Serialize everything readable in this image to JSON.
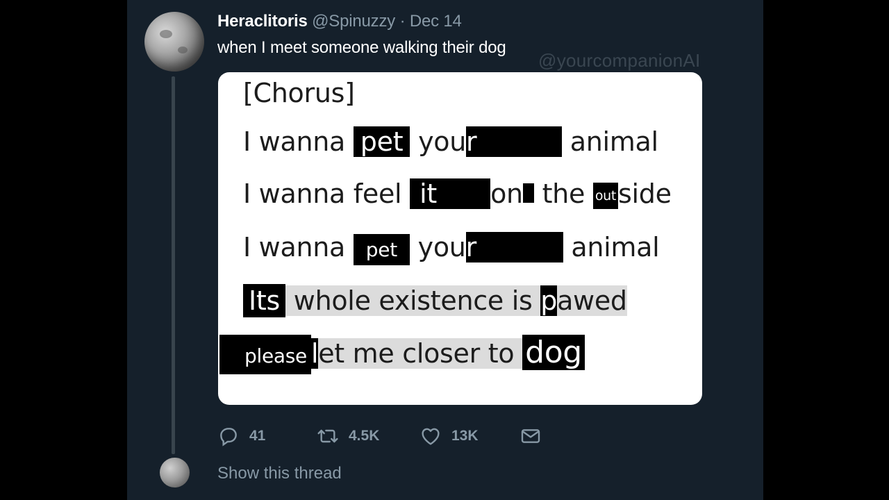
{
  "tweet": {
    "display_name": "Heraclitoris",
    "handle": "@Spinuzzy",
    "separator": "·",
    "date": "Dec 14",
    "text": "when I meet someone walking their dog",
    "watermark": "@yourcompanionAI"
  },
  "lyrics": {
    "header": "[Chorus]",
    "line1": {
      "a": "I wanna ",
      "b": "pet",
      "c": " you",
      "d": "r",
      "e": " animal"
    },
    "line2": {
      "a": "I wanna feel ",
      "b": "it",
      "c": "on",
      "d": " the ",
      "e": "out",
      "f": "side"
    },
    "line3": {
      "a": "I wanna ",
      "b": "pet",
      "c": " you",
      "d": "r",
      "e": " animal"
    },
    "line4": {
      "a": "Its",
      "b": " whole existence is ",
      "c": "p",
      "d": "awed"
    },
    "line5": {
      "a": "please ",
      "b": "l",
      "c": "et me closer to ",
      "d": "dog"
    }
  },
  "actions": {
    "reply": {
      "icon": "reply-icon",
      "count": "41"
    },
    "retweet": {
      "icon": "retweet-icon",
      "count": "4.5K"
    },
    "like": {
      "icon": "heart-icon",
      "count": "13K"
    },
    "share": {
      "icon": "mail-icon"
    }
  },
  "footer": {
    "show_thread": "Show this thread"
  },
  "colors": {
    "background": "#15202b",
    "muted_text": "#8899a6",
    "thread_line": "#38444d"
  }
}
